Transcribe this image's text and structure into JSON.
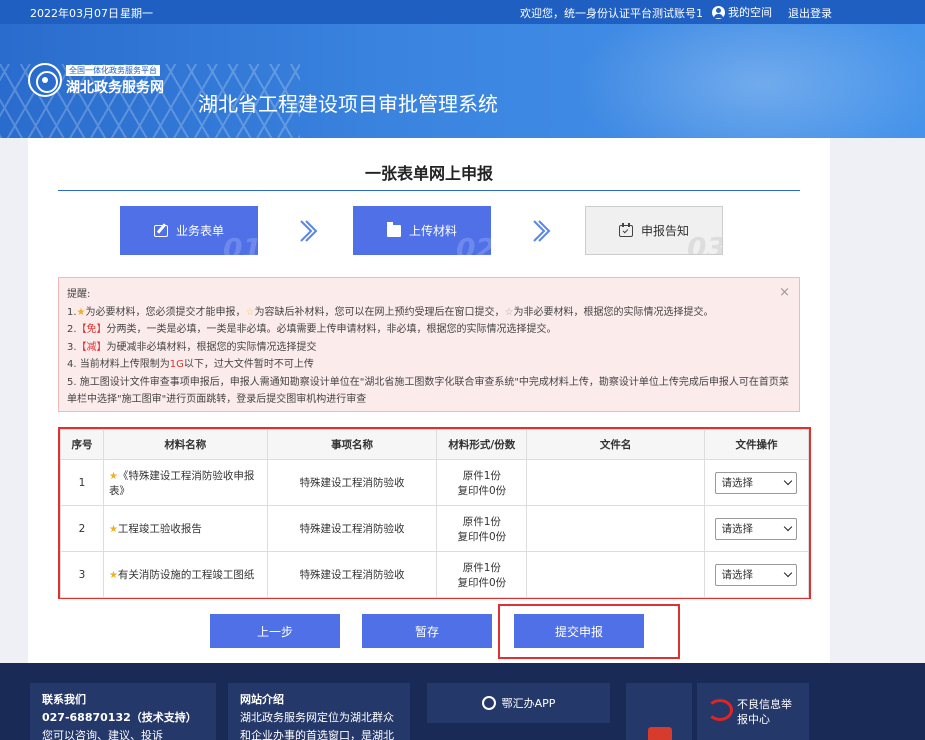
{
  "topbar": {
    "date": "2022年03月07日",
    "weekday": "星期一",
    "welcome": "欢迎您，统一身份认证平台测试账号1",
    "myspace": "我的空间",
    "logout": "退出登录"
  },
  "header": {
    "platform_tag": "全国一体化政务服务平台",
    "portal_name": "湖北政务服务网",
    "system_name": "湖北省工程建设项目审批管理系统"
  },
  "page": {
    "title": "一张表单网上申报"
  },
  "steps": [
    {
      "label": "业务表单",
      "num": "01",
      "icon": "edit-icon",
      "state": "active"
    },
    {
      "label": "上传材料",
      "num": "02",
      "icon": "folder-icon",
      "state": "active"
    },
    {
      "label": "申报告知",
      "num": "03",
      "icon": "calendar-icon",
      "state": "inactive"
    }
  ],
  "alert": {
    "heading": "提醒:",
    "line1_a": "1.",
    "line1_b": "为必要材料，您必须提交才能申报，",
    "line1_c": "为容缺后补材料，您可以在网上预约受理后在窗口提交，",
    "line1_d": "为非必要材料，根据您的实际情况选择提交。",
    "line2_a": "2.",
    "line2_tag": "【免】",
    "line2_b": "分两类，一类是必填，一类是非必填。必填需要上传申请材料，非必填，根据您的实际情况选择提交。",
    "line3_a": "3.",
    "line3_tag": "【减】",
    "line3_b": "为硬减非必填材料，根据您的实际情况选择提交",
    "line4_a": "4. 当前材料上传限制为",
    "line4_tag": "1G",
    "line4_b": "以下，过大文件暂时不可上传",
    "line5": "5. 施工图设计文件审查事项申报后，申报人需通知勘察设计单位在\"湖北省施工图数字化联合审查系统\"中完成材料上传，勘察设计单位上传完成后申报人可在首页菜单栏中选择\"施工图审\"进行页面跳转，登录后提交图审机构进行审查",
    "close": "×"
  },
  "table": {
    "headers": [
      "序号",
      "材料名称",
      "事项名称",
      "材料形式/份数",
      "文件名",
      "文件操作"
    ],
    "rows": [
      {
        "no": "1",
        "name": "《特殊建设工程消防验收申报表》",
        "item": "特殊建设工程消防验收",
        "orig": "原件1份",
        "copy": "复印件0份",
        "file": "",
        "op": "请选择"
      },
      {
        "no": "2",
        "name": "工程竣工验收报告",
        "item": "特殊建设工程消防验收",
        "orig": "原件1份",
        "copy": "复印件0份",
        "file": "",
        "op": "请选择"
      },
      {
        "no": "3",
        "name": "有关消防设施的工程竣工图纸",
        "item": "特殊建设工程消防验收",
        "orig": "原件1份",
        "copy": "复印件0份",
        "file": "",
        "op": "请选择"
      }
    ]
  },
  "buttons": {
    "prev": "上一步",
    "save": "暂存",
    "submit": "提交申报"
  },
  "footer": {
    "contact_title": "联系我们",
    "contact_phone": "027-68870132（技术支持）",
    "contact_more": "您可以咨询、建议、投诉",
    "about_title": "网站介绍",
    "about_line1": "湖北政务服务网定位为湖北群众",
    "about_line2": "和企业办事的首选窗口，是湖北",
    "app_label": "鄂汇办APP",
    "report_line1": "不良信息举",
    "report_line2": "报中心"
  },
  "colors": {
    "primary": "#4f70e7",
    "header_blue": "#2a6ccd",
    "highlight_red": "#e03030",
    "footer": "#1a2a57"
  }
}
